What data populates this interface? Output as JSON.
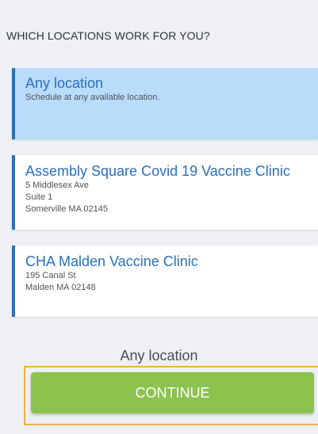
{
  "header": {
    "title": "WHICH LOCATIONS WORK FOR YOU?"
  },
  "locations": [
    {
      "title": "Any location",
      "lines": [
        "Schedule at any available location."
      ],
      "selected": true
    },
    {
      "title": "Assembly Square Covid 19 Vaccine Clinic",
      "lines": [
        "5 Middlesex Ave",
        "Suite 1",
        "Somerville MA 02145"
      ],
      "selected": false
    },
    {
      "title": "CHA Malden Vaccine Clinic",
      "lines": [
        "195 Canal St",
        "Malden MA 02148"
      ],
      "selected": false
    }
  ],
  "selection": {
    "label": "Any location"
  },
  "actions": {
    "continue_label": "CONTINUE"
  },
  "colors": {
    "accent_blue": "#2b6fbf",
    "selected_bg": "#b9dcfb",
    "continue_green": "#8cc34f",
    "focus_outline": "#e9b24a"
  }
}
